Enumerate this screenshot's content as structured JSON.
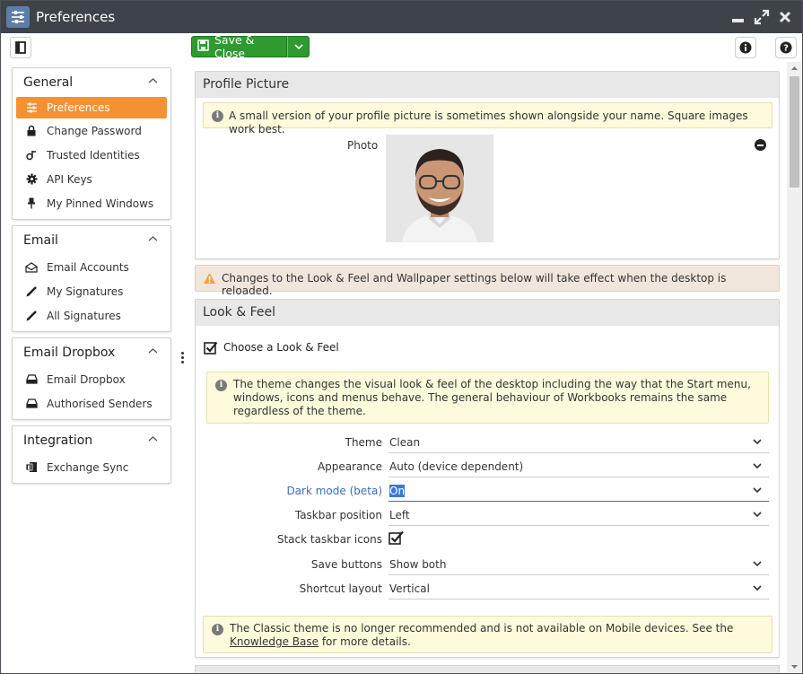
{
  "window": {
    "title": "Preferences",
    "icons": [
      "sliders-icon",
      "minimize-icon",
      "maximize-icon",
      "close-icon"
    ]
  },
  "toolbar": {
    "save_label": "Save & Close",
    "accent": "#2f9a2f"
  },
  "sidebar": {
    "groups": [
      {
        "title": "General",
        "items": [
          {
            "label": "Preferences",
            "icon": "sliders-icon",
            "active": true
          },
          {
            "label": "Change Password",
            "icon": "lock-icon"
          },
          {
            "label": "Trusted Identities",
            "icon": "trusted-identity-icon"
          },
          {
            "label": "API Keys",
            "icon": "gear-icon"
          },
          {
            "label": "My Pinned Windows",
            "icon": "pin-icon"
          }
        ]
      },
      {
        "title": "Email",
        "items": [
          {
            "label": "Email Accounts",
            "icon": "envelope-icon"
          },
          {
            "label": "My Signatures",
            "icon": "pen-icon"
          },
          {
            "label": "All Signatures",
            "icon": "pen-icon"
          }
        ]
      },
      {
        "title": "Email Dropbox",
        "items": [
          {
            "label": "Email Dropbox",
            "icon": "inbox-icon"
          },
          {
            "label": "Authorised Senders",
            "icon": "inbox-icon"
          }
        ]
      },
      {
        "title": "Integration",
        "items": [
          {
            "label": "Exchange Sync",
            "icon": "exchange-icon"
          }
        ]
      }
    ],
    "active_color": "#f39234"
  },
  "profile": {
    "title": "Profile Picture",
    "info": "A small version of your profile picture is sometimes shown alongside your name. Square images work best.",
    "photo_label": "Photo"
  },
  "reload_warning": "Changes to the Look & Feel and Wallpaper settings below will take effect when the desktop is reloaded.",
  "look_feel": {
    "title": "Look & Feel",
    "choose_label": "Choose a Look & Feel",
    "choose_checked": true,
    "info": "The theme changes the visual look & feel of the desktop including the way that the Start menu, windows, icons and menus behave. The general behaviour of Workbooks remains the same regardless of the theme.",
    "fields": [
      {
        "label": "Theme",
        "value": "Clean",
        "type": "select"
      },
      {
        "label": "Appearance",
        "value": "Auto (device dependent)",
        "type": "select"
      },
      {
        "label": "Dark mode (beta)",
        "value": "On",
        "type": "select",
        "focused": true
      },
      {
        "label": "Taskbar position",
        "value": "Left",
        "type": "select"
      },
      {
        "label": "Stack taskbar icons",
        "value": true,
        "type": "checkbox"
      },
      {
        "label": "Save buttons",
        "value": "Show both",
        "type": "select"
      },
      {
        "label": "Shortcut layout",
        "value": "Vertical",
        "type": "select"
      }
    ],
    "classic_note_pre": "The Classic theme is no longer recommended and is not available on Mobile devices. See the ",
    "classic_note_link": "Knowledge Base",
    "classic_note_post": " for more details."
  }
}
